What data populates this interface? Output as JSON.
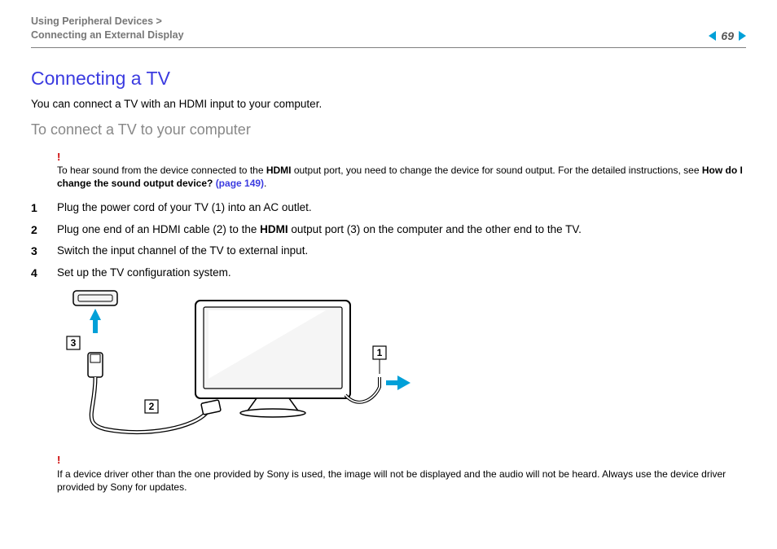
{
  "header": {
    "breadcrumb_line1": "Using Peripheral Devices >",
    "breadcrumb_line2": "Connecting an External Display",
    "page_number": "69"
  },
  "title": "Connecting a TV",
  "intro": "You can connect a TV with an HDMI input to your computer.",
  "subhead": "To connect a TV to your computer",
  "note1": {
    "bang": "!",
    "pre": "To hear sound from the device connected to the ",
    "hdmi1": "HDMI",
    "mid": " output port, you need to change the device for sound output. For the detailed instructions, see ",
    "bold_link_text": "How do I change the sound output device? ",
    "page_ref": "(page 149)",
    "period": "."
  },
  "steps": [
    {
      "text_pre": "Plug the power cord of your TV (1) into an AC outlet.",
      "bold": ""
    },
    {
      "text_pre": "Plug one end of an HDMI cable (2) to the ",
      "bold": "HDMI",
      "text_post": " output port (3) on the computer and the other end to the TV."
    },
    {
      "text_pre": "Switch the input channel of the TV to external input.",
      "bold": ""
    },
    {
      "text_pre": "Set up the TV configuration system.",
      "bold": ""
    }
  ],
  "diagram_labels": {
    "l1": "1",
    "l2": "2",
    "l3": "3"
  },
  "note2": {
    "bang": "!",
    "text": "If a device driver other than the one provided by Sony is used, the image will not be displayed and the audio will not be heard. Always use the device driver provided by Sony for updates."
  }
}
